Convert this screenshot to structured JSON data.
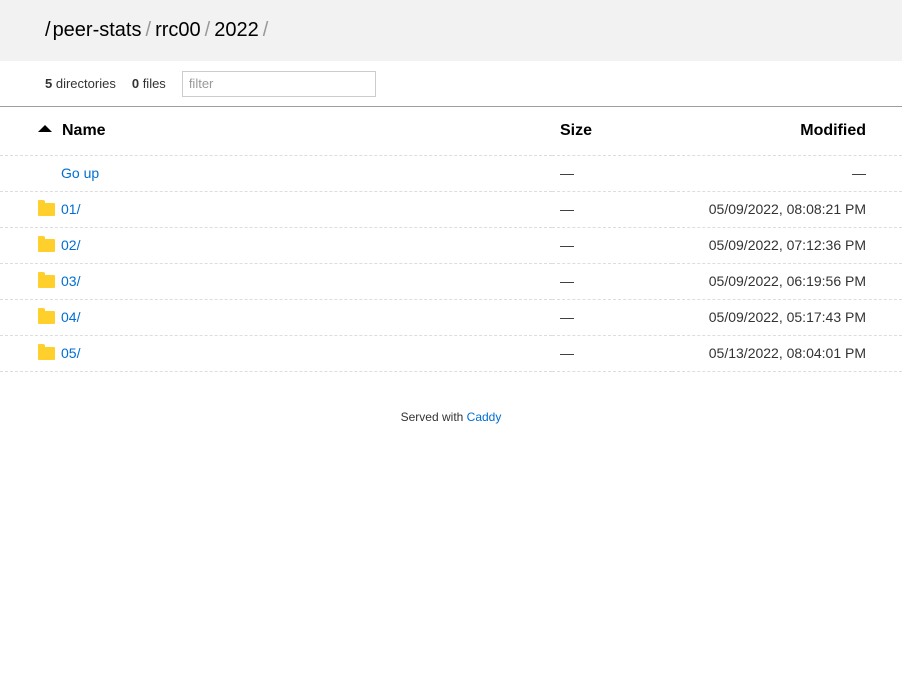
{
  "breadcrumb": {
    "root_sep": "/",
    "sep": "/",
    "items": [
      "peer-stats",
      "rrc00",
      "2022"
    ]
  },
  "meta": {
    "dir_count": "5",
    "dir_label": "directories",
    "file_count": "0",
    "file_label": "files",
    "filter_placeholder": "filter"
  },
  "table": {
    "headers": {
      "name": "Name",
      "size": "Size",
      "modified": "Modified"
    },
    "go_up": {
      "label": "Go up",
      "size": "—",
      "modified": "—"
    },
    "rows": [
      {
        "name": "01/",
        "size": "—",
        "modified": "05/09/2022, 08:08:21 PM"
      },
      {
        "name": "02/",
        "size": "—",
        "modified": "05/09/2022, 07:12:36 PM"
      },
      {
        "name": "03/",
        "size": "—",
        "modified": "05/09/2022, 06:19:56 PM"
      },
      {
        "name": "04/",
        "size": "—",
        "modified": "05/09/2022, 05:17:43 PM"
      },
      {
        "name": "05/",
        "size": "—",
        "modified": "05/13/2022, 08:04:01 PM"
      }
    ]
  },
  "footer": {
    "text": "Served with",
    "link": "Caddy"
  },
  "colors": {
    "link": "#006ed3",
    "folder": "#ffd02c",
    "header_bg": "#f2f2f2"
  },
  "icons": {
    "folder": "folder-icon",
    "sort": "sort-ascending-icon"
  }
}
